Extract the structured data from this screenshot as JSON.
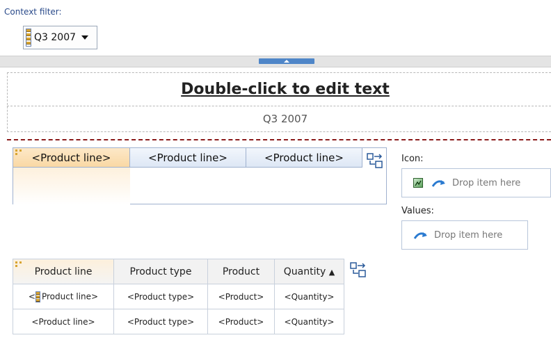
{
  "context_filter": {
    "label": "Context filter:",
    "selected_value": "Q3 2007"
  },
  "header": {
    "title": "Double-click to edit text",
    "subtitle": "Q3 2007"
  },
  "tabs": [
    {
      "label": "<Product line>",
      "active": true
    },
    {
      "label": "<Product line>",
      "active": false
    },
    {
      "label": "<Product line>",
      "active": false
    }
  ],
  "icon_zone": {
    "label": "Icon:",
    "drop_text": "Drop item here"
  },
  "values_zone": {
    "label": "Values:",
    "drop_text": "Drop item here"
  },
  "table": {
    "columns": [
      "Product line",
      "Product type",
      "Product",
      "Quantity"
    ],
    "sort_indicator": "▲",
    "rows": [
      [
        "Product line>",
        "<Product type>",
        "<Product>",
        "<Quantity>"
      ],
      [
        "<Product line>",
        "<Product type>",
        "<Product>",
        "<Quantity>"
      ]
    ],
    "row1_prefix": "<"
  },
  "colors": {
    "accent": "#4f86c8",
    "active_tab": "#f9d8a4",
    "divider_red": "#8a1a1a"
  }
}
